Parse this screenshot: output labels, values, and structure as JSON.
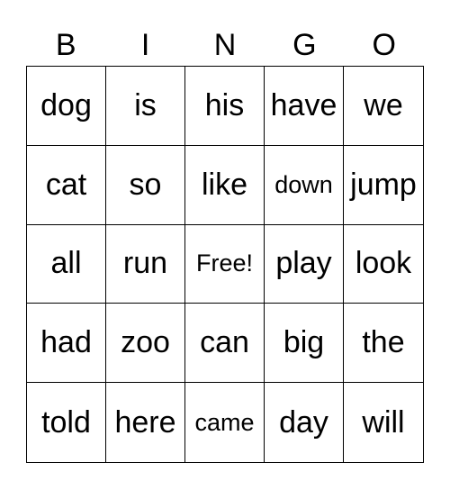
{
  "header": [
    "B",
    "I",
    "N",
    "G",
    "O"
  ],
  "cells": [
    [
      "dog",
      "is",
      "his",
      "have",
      "we"
    ],
    [
      "cat",
      "so",
      "like",
      "down",
      "jump"
    ],
    [
      "all",
      "run",
      "Free!",
      "play",
      "look"
    ],
    [
      "had",
      "zoo",
      "can",
      "big",
      "the"
    ],
    [
      "told",
      "here",
      "came",
      "day",
      "will"
    ]
  ]
}
